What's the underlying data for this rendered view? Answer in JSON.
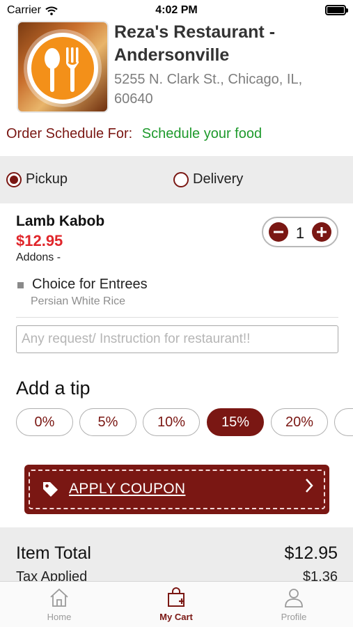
{
  "status_bar": {
    "carrier": "Carrier",
    "time": "4:02 PM"
  },
  "restaurant": {
    "name": "Reza's Restaurant - Andersonville",
    "address": "5255 N. Clark St., Chicago, IL, 60640",
    "logo_icon": "spoon-fork-icon"
  },
  "schedule": {
    "label": "Order Schedule For:",
    "link": "Schedule your food"
  },
  "order_type": {
    "options": [
      {
        "label": "Pickup",
        "selected": true
      },
      {
        "label": "Delivery",
        "selected": false
      }
    ]
  },
  "cart_item": {
    "name": "Lamb Kabob",
    "price": "$12.95",
    "addons_label": "Addons -",
    "quantity": "1",
    "addon_group": "Choice for Entrees",
    "addon_choice": "Persian White Rice"
  },
  "instructions": {
    "placeholder": "Any request/ Instruction for restaurant!!"
  },
  "tip": {
    "title": "Add a tip",
    "options": [
      "0%",
      "5%",
      "10%",
      "15%",
      "20%"
    ],
    "selected": "15%"
  },
  "coupon": {
    "label": "APPLY COUPON"
  },
  "totals": {
    "item_total_label": "Item Total",
    "item_total_value": "$12.95",
    "tax_label": "Tax Applied",
    "tax_value": "$1.36"
  },
  "tab_bar": {
    "tabs": [
      {
        "label": "Home",
        "icon": "home-icon",
        "active": false
      },
      {
        "label": "My Cart",
        "icon": "cart-bag-icon",
        "active": true
      },
      {
        "label": "Profile",
        "icon": "profile-icon",
        "active": false
      }
    ]
  },
  "colors": {
    "brand": "#7a1713",
    "price_red": "#e0262b",
    "link_green": "#1e9a2c",
    "logo_orange": "#f39019"
  }
}
